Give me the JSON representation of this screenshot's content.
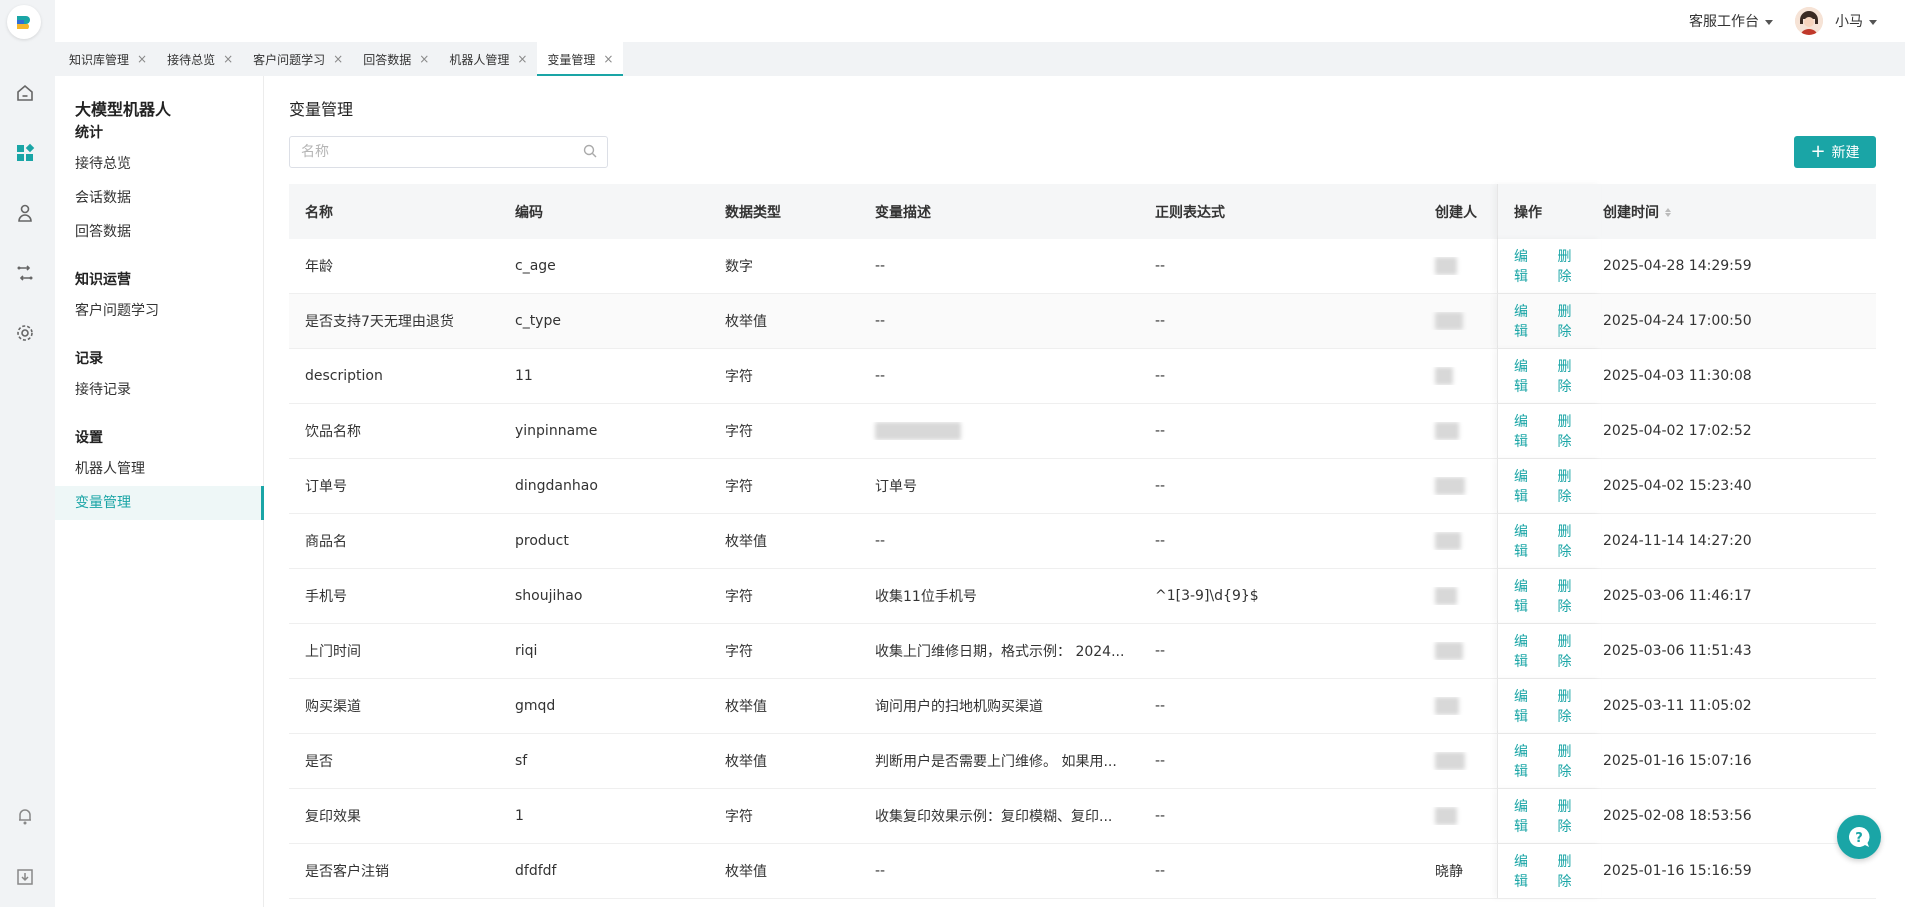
{
  "topbar": {
    "workspace": "客服工作台",
    "user": "小马"
  },
  "tabs": [
    {
      "label": "知识库管理",
      "active": false
    },
    {
      "label": "接待总览",
      "active": false
    },
    {
      "label": "客户问题学习",
      "active": false
    },
    {
      "label": "回答数据",
      "active": false
    },
    {
      "label": "机器人管理",
      "active": false
    },
    {
      "label": "变量管理",
      "active": true
    }
  ],
  "tab_close": "×",
  "sidebar": {
    "title": "大模型机器人",
    "groups": [
      {
        "label": "统计",
        "items": [
          "接待总览",
          "会话数据",
          "回答数据"
        ]
      },
      {
        "label": "知识运营",
        "items": [
          "客户问题学习"
        ]
      },
      {
        "label": "记录",
        "items": [
          "接待记录"
        ]
      },
      {
        "label": "设置",
        "items": [
          "机器人管理",
          "变量管理"
        ]
      }
    ],
    "active_item": "变量管理"
  },
  "main": {
    "title": "变量管理",
    "search_placeholder": "名称",
    "new_button": "新建",
    "columns": [
      "名称",
      "编码",
      "数据类型",
      "变量描述",
      "正则表达式",
      "创建人",
      "创建时间",
      "操作"
    ],
    "edit_label": "编辑",
    "delete_label": "删除",
    "rows": [
      {
        "name": "年龄",
        "code": "c_age",
        "type": "数字",
        "desc": "--",
        "regex": "--",
        "creator": "",
        "time": "2025-04-28 14:29:59"
      },
      {
        "name": "是否支持7天无理由退货",
        "code": "c_type",
        "type": "枚举值",
        "desc": "--",
        "regex": "--",
        "creator": "",
        "time": "2025-04-24 17:00:50"
      },
      {
        "name": "description",
        "code": "11",
        "type": "字符",
        "desc": "--",
        "regex": "--",
        "creator": "",
        "time": "2025-04-03 11:30:08"
      },
      {
        "name": "饮品名称",
        "code": "yinpinname",
        "type": "字符",
        "desc": "",
        "regex": "--",
        "creator": "",
        "time": "2025-04-02 17:02:52"
      },
      {
        "name": "订单号",
        "code": "dingdanhao",
        "type": "字符",
        "desc": "订单号",
        "regex": "--",
        "creator": "",
        "time": "2025-04-02 15:23:40"
      },
      {
        "name": "商品名",
        "code": "product",
        "type": "枚举值",
        "desc": "--",
        "regex": "--",
        "creator": "",
        "time": "2024-11-14 14:27:20"
      },
      {
        "name": "手机号",
        "code": "shoujihao",
        "type": "字符",
        "desc": "收集11位手机号",
        "regex": "^1[3-9]\\d{9}$",
        "creator": "",
        "time": "2025-03-06 11:46:17"
      },
      {
        "name": "上门时间",
        "code": "riqi",
        "type": "字符",
        "desc": "收集上门维修日期，格式示例： 2024...",
        "regex": "--",
        "creator": "",
        "time": "2025-03-06 11:51:43"
      },
      {
        "name": "购买渠道",
        "code": "gmqd",
        "type": "枚举值",
        "desc": "询问用户的扫地机购买渠道",
        "regex": "--",
        "creator": "",
        "time": "2025-03-11 11:05:02"
      },
      {
        "name": "是否",
        "code": "sf",
        "type": "枚举值",
        "desc": "判断用户是否需要上门维修。 如果用...",
        "regex": "--",
        "creator": "",
        "time": "2025-01-16 15:07:16"
      },
      {
        "name": "复印效果",
        "code": "1",
        "type": "字符",
        "desc": "收集复印效果示例：复印模糊、复印...",
        "regex": "--",
        "creator": "",
        "time": "2025-02-08 18:53:56"
      },
      {
        "name": "是否客户注销",
        "code": "dfdfdf",
        "type": "枚举值",
        "desc": "--",
        "regex": "--",
        "creator": "晓静",
        "time": "2025-01-16 15:16:59"
      }
    ]
  },
  "colors": {
    "accent": "#1aa5a6",
    "rail": "#f1f3f5"
  }
}
